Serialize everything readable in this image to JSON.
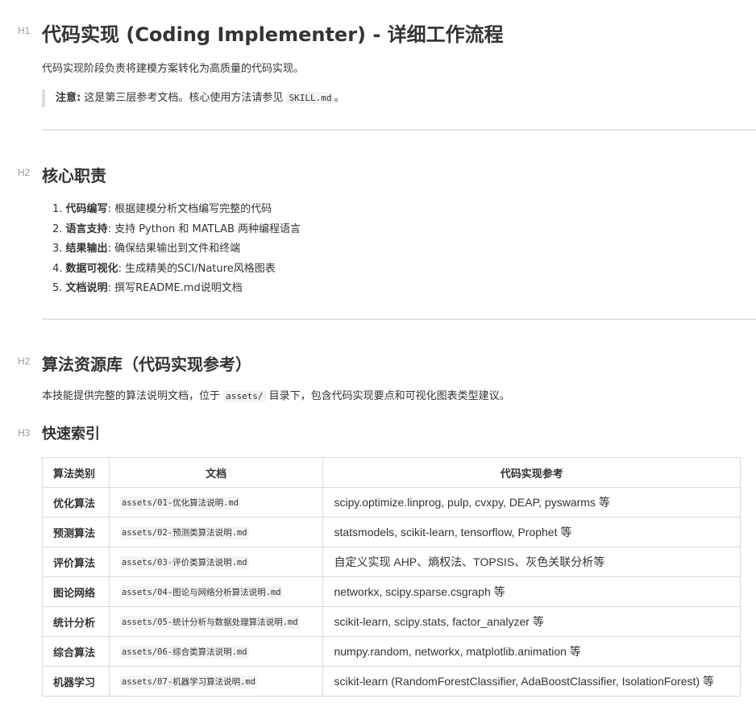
{
  "h1": {
    "marker": "H1",
    "title": "代码实现 (Coding Implementer) - 详细工作流程"
  },
  "intro": "代码实现阶段负责将建模方案转化为高质量的代码实现。",
  "note": {
    "label": "注意:",
    "text_before": " 这是第三层参考文档。核心使用方法请参见 ",
    "code": "SKILL.md",
    "text_after": "。"
  },
  "core": {
    "marker": "H2",
    "title": "核心职责",
    "items": [
      {
        "num": "1.",
        "label": "代码编写",
        "text": ": 根据建模分析文档编写完整的代码"
      },
      {
        "num": "2.",
        "label": "语言支持",
        "text": ": 支持 Python 和 MATLAB 两种编程语言"
      },
      {
        "num": "3.",
        "label": "结果输出",
        "text": ": 确保结果输出到文件和终端"
      },
      {
        "num": "4.",
        "label": "数据可视化",
        "text": ": 生成精美的SCI/Nature风格图表"
      },
      {
        "num": "5.",
        "label": "文档说明",
        "text": ": 撰写README.md说明文档"
      }
    ]
  },
  "library": {
    "marker": "H2",
    "title": "算法资源库（代码实现参考）",
    "desc_before": "本技能提供完整的算法说明文档，位于 ",
    "desc_code": "assets/",
    "desc_after": " 目录下，包含代码实现要点和可视化图表类型建议。"
  },
  "quick_index": {
    "marker": "H3",
    "title": "快速索引",
    "headers": [
      "算法类别",
      "文档",
      "代码实现参考"
    ],
    "rows": [
      {
        "category": "优化算法",
        "doc": "assets/01-优化算法说明.md",
        "ref": "scipy.optimize.linprog, pulp, cvxpy, DEAP, pyswarms 等"
      },
      {
        "category": "预测算法",
        "doc": "assets/02-预测类算法说明.md",
        "ref": "statsmodels, scikit-learn, tensorflow, Prophet 等"
      },
      {
        "category": "评价算法",
        "doc": "assets/03-评价类算法说明.md",
        "ref": "自定义实现 AHP、熵权法、TOPSIS、灰色关联分析等"
      },
      {
        "category": "图论网络",
        "doc": "assets/04-图论与网络分析算法说明.md",
        "ref": "networkx, scipy.sparse.csgraph 等"
      },
      {
        "category": "统计分析",
        "doc": "assets/05-统计分析与数据处理算法说明.md",
        "ref": "scikit-learn, scipy.stats, factor_analyzer 等"
      },
      {
        "category": "综合算法",
        "doc": "assets/06-综合类算法说明.md",
        "ref": "numpy.random, networkx, matplotlib.animation 等"
      },
      {
        "category": "机器学习",
        "doc": "assets/07-机器学习算法说明.md",
        "ref": "scikit-learn (RandomForestClassifier, AdaBoostClassifier, IsolationForest) 等"
      }
    ]
  }
}
